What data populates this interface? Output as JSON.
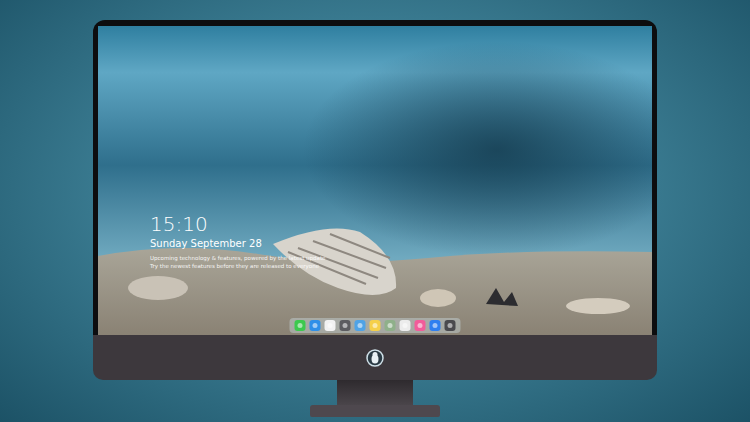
{
  "lock_screen": {
    "time": "15:10",
    "date": "Sunday September 28",
    "notes": [
      "Upcoming technology & features, powered by the latest update",
      "Try the newest features before they are released to everyone"
    ]
  },
  "dock": {
    "items": [
      {
        "color": "#3cc94e"
      },
      {
        "color": "#2f8fe8"
      },
      {
        "color": "#f2f2f2"
      },
      {
        "color": "#5c5c60"
      },
      {
        "color": "#4fa3e6"
      },
      {
        "color": "#f5d04a"
      },
      {
        "color": "#8fb08a"
      },
      {
        "color": "#ececec"
      },
      {
        "color": "#f25c9a"
      },
      {
        "color": "#2f7ff0"
      },
      {
        "color": "#4a4a4e"
      }
    ]
  }
}
